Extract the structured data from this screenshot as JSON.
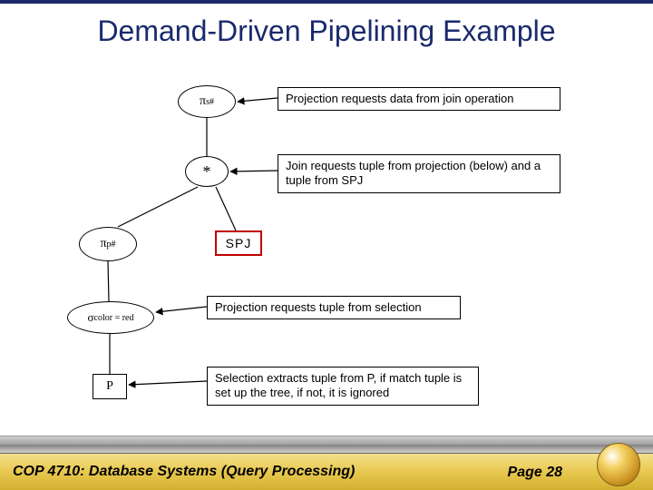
{
  "title": "Demand-Driven Pipelining Example",
  "nodes": {
    "proj_s": {
      "symbol": "π",
      "sub": "s#"
    },
    "join": {
      "symbol": "*"
    },
    "proj_p": {
      "symbol": "π",
      "sub": "p#"
    },
    "spj": {
      "label": "SPJ"
    },
    "sel": {
      "symbol": "σ",
      "sub": "color = red"
    },
    "rel_p": {
      "label": "P"
    }
  },
  "annotations": {
    "a1": "Projection requests data from join operation",
    "a2": "Join requests tuple from projection (below) and a tuple from SPJ",
    "a3": "Projection requests tuple from selection",
    "a4": "Selection extracts tuple from P, if match tuple is set up the tree, if not, it is ignored"
  },
  "footer": {
    "course": "COP 4710: Database Systems (Query Processing)",
    "page": "Page 28"
  }
}
